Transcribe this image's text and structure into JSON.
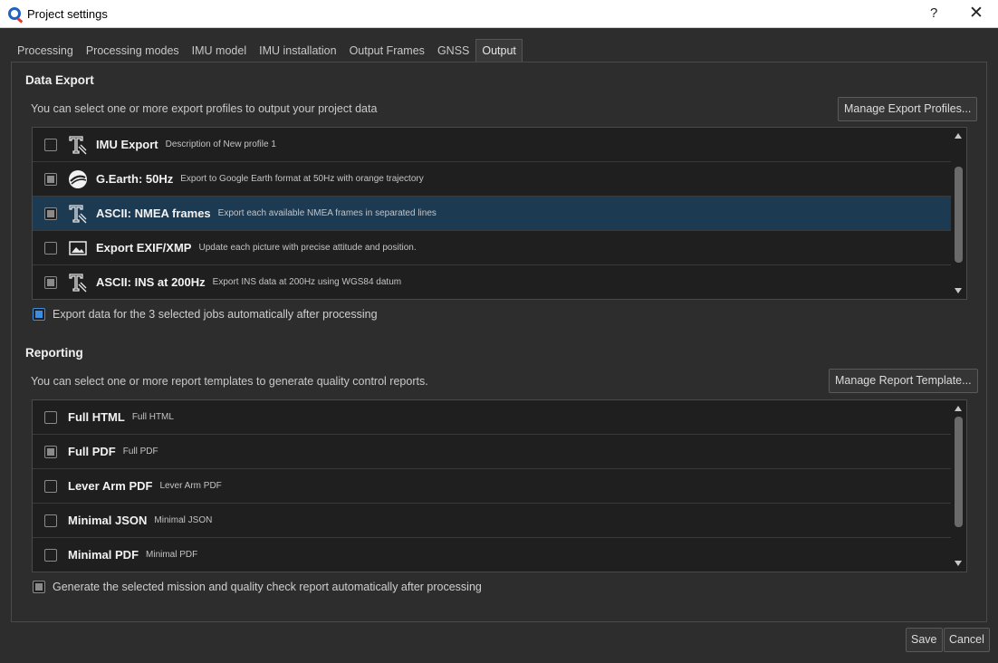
{
  "window": {
    "title": "Project settings",
    "help_label": "?",
    "close_label": "✕"
  },
  "tabs": [
    {
      "label": "Processing"
    },
    {
      "label": "Processing modes"
    },
    {
      "label": "IMU model"
    },
    {
      "label": "IMU installation"
    },
    {
      "label": "Output Frames"
    },
    {
      "label": "GNSS"
    },
    {
      "label": "Output",
      "active": true
    }
  ],
  "data_export": {
    "title": "Data Export",
    "description": "You can select one or more export profiles to output your project data",
    "manage_button": "Manage Export Profiles...",
    "profiles": [
      {
        "name": "IMU Export",
        "description": "Description of New profile 1",
        "icon": "text-tool-icon",
        "state": "unchecked"
      },
      {
        "name": "G.Earth: 50Hz",
        "description": "Export to Google Earth format at 50Hz with orange trajectory",
        "icon": "google-earth-icon",
        "state": "partial"
      },
      {
        "name": "ASCII: NMEA frames",
        "description": "Export each available NMEA frames in separated lines",
        "icon": "text-tool-icon",
        "state": "partial",
        "selected": true
      },
      {
        "name": "Export EXIF/XMP",
        "description": "Update each picture with precise attitude and position.",
        "icon": "image-icon",
        "state": "unchecked"
      },
      {
        "name": "ASCII: INS at 200Hz",
        "description": "Export INS data at 200Hz using WGS84 datum",
        "icon": "text-tool-icon",
        "state": "partial"
      }
    ],
    "auto_export_label": "Export data for the 3 selected jobs automatically after processing"
  },
  "reporting": {
    "title": "Reporting",
    "description": "You can select one or more report templates to generate quality control reports.",
    "manage_button": "Manage Report Template...",
    "templates": [
      {
        "name": "Full HTML",
        "description": "Full HTML",
        "state": "unchecked"
      },
      {
        "name": "Full PDF",
        "description": "Full PDF",
        "state": "partial"
      },
      {
        "name": "Lever Arm PDF",
        "description": "Lever Arm PDF",
        "state": "unchecked"
      },
      {
        "name": "Minimal JSON",
        "description": "Minimal JSON",
        "state": "unchecked"
      },
      {
        "name": "Minimal PDF",
        "description": "Minimal PDF",
        "state": "unchecked"
      }
    ],
    "auto_report_label": "Generate the selected mission and quality check report automatically after processing"
  },
  "footer": {
    "save_label": "Save",
    "cancel_label": "Cancel"
  }
}
